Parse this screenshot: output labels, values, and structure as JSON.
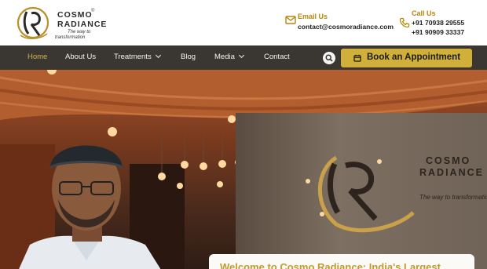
{
  "brand": {
    "name_line1": "COSMO",
    "name_line2": "RADIANCE",
    "registered": "®",
    "tagline_line1": "The way to",
    "tagline_line2": "transformation",
    "logo_letters": "CR"
  },
  "contact": {
    "email": {
      "title": "Email Us",
      "value": "contact@cosmoradiance.com",
      "icon": "mail-icon"
    },
    "phone": {
      "title": "Call Us",
      "lines": [
        "+91 70938 29555",
        "+91 90909 33337"
      ],
      "icon": "phone-icon"
    }
  },
  "nav": {
    "items": [
      {
        "label": "Home",
        "active": true
      },
      {
        "label": "About Us"
      },
      {
        "label": "Treatments",
        "dropdown": true
      },
      {
        "label": "Blog"
      },
      {
        "label": "Media",
        "dropdown": true
      },
      {
        "label": "Contact"
      }
    ],
    "search_icon": "search-icon",
    "book_button": {
      "label": "Book an Appointment",
      "icon": "calendar-icon"
    }
  },
  "hero": {
    "wall_logo_line1": "COSMO",
    "wall_logo_line2": "RADIANCE",
    "wall_logo_tagline": "The way to transformation",
    "welcome_text": "Welcome to Cosmo Radiance: India's Largest"
  },
  "colors": {
    "accent_gold": "#d0b03a",
    "nav_bg": "#3a3632",
    "active_nav": "#d4b64a"
  }
}
